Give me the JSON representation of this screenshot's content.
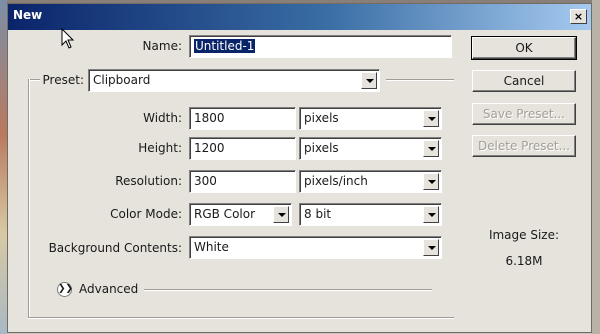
{
  "window": {
    "title": "New",
    "close_label": "×"
  },
  "form": {
    "name": {
      "label": "Name:",
      "value": "Untitled-1"
    },
    "preset": {
      "label": "Preset:",
      "value": "Clipboard"
    },
    "width": {
      "label": "Width:",
      "value": "1800",
      "unit": "pixels"
    },
    "height": {
      "label": "Height:",
      "value": "1200",
      "unit": "pixels"
    },
    "resolution": {
      "label": "Resolution:",
      "value": "300",
      "unit": "pixels/inch"
    },
    "color_mode": {
      "label": "Color Mode:",
      "value": "RGB Color",
      "depth": "8 bit"
    },
    "background": {
      "label": "Background Contents:",
      "value": "White"
    },
    "advanced": {
      "label": "Advanced"
    }
  },
  "buttons": {
    "ok": "OK",
    "cancel": "Cancel",
    "save_preset": "Save Preset...",
    "delete_preset": "Delete Preset..."
  },
  "image_size": {
    "label": "Image Size:",
    "value": "6.18M"
  }
}
